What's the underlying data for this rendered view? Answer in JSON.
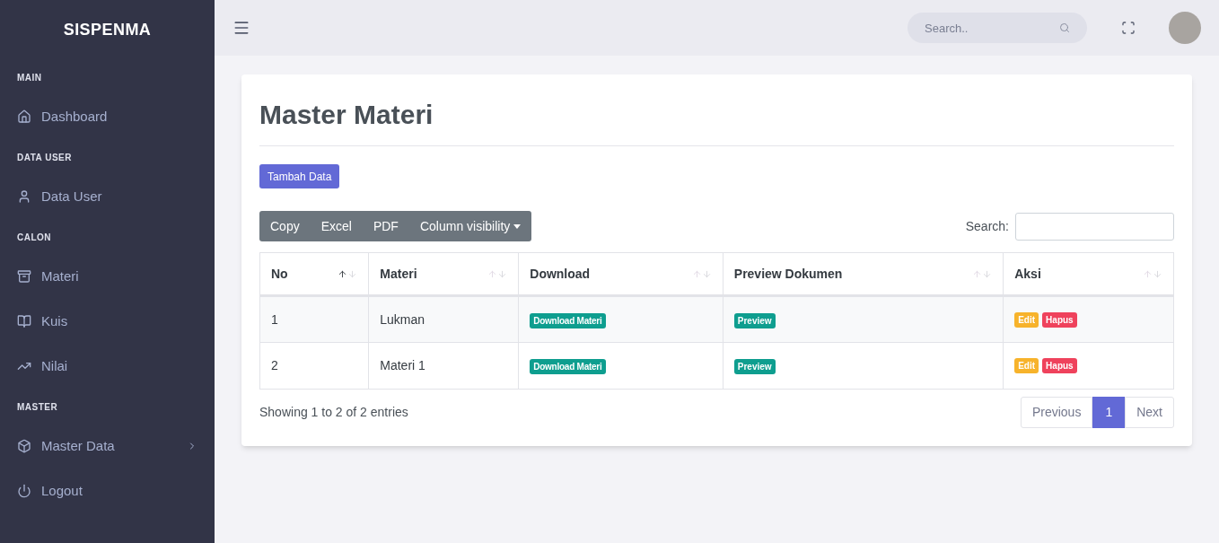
{
  "sidebar": {
    "logo": "SISPENMA",
    "sections": [
      {
        "heading": "MAIN",
        "items": [
          {
            "label": "Dashboard",
            "has_submenu": false
          }
        ]
      },
      {
        "heading": "DATA USER",
        "items": [
          {
            "label": "Data User",
            "has_submenu": false
          }
        ]
      },
      {
        "heading": "CALON",
        "items": [
          {
            "label": "Materi",
            "has_submenu": false
          },
          {
            "label": "Kuis",
            "has_submenu": false
          },
          {
            "label": "Nilai",
            "has_submenu": false
          }
        ]
      },
      {
        "heading": "MASTER",
        "items": [
          {
            "label": "Master Data",
            "has_submenu": true
          },
          {
            "label": "Logout",
            "has_submenu": false
          }
        ]
      }
    ]
  },
  "topbar": {
    "search": {
      "placeholder": "Search.."
    }
  },
  "page": {
    "title": "Master Materi",
    "add_button": "Tambah Data",
    "export_buttons": [
      "Copy",
      "Excel",
      "PDF",
      "Column visibility"
    ],
    "search_label": "Search:",
    "table": {
      "columns": [
        {
          "label": "No",
          "sorted": true
        },
        {
          "label": "Materi",
          "sorted": false
        },
        {
          "label": "Download",
          "sorted": false
        },
        {
          "label": "Preview Dokumen",
          "sorted": false
        },
        {
          "label": "Aksi",
          "sorted": false
        }
      ],
      "rows": [
        {
          "no": "1",
          "materi": "Lukman",
          "download": "Download Materi",
          "preview": "Preview",
          "edit": "Edit",
          "delete": "Hapus"
        },
        {
          "no": "2",
          "materi": "Materi 1",
          "download": "Download Materi",
          "preview": "Preview",
          "edit": "Edit",
          "delete": "Hapus"
        }
      ]
    },
    "info": "Showing 1 to 2 of 2 entries",
    "pagination": {
      "previous": "Previous",
      "pages": [
        {
          "label": "1",
          "selected": true
        }
      ],
      "next": "Next"
    }
  }
}
